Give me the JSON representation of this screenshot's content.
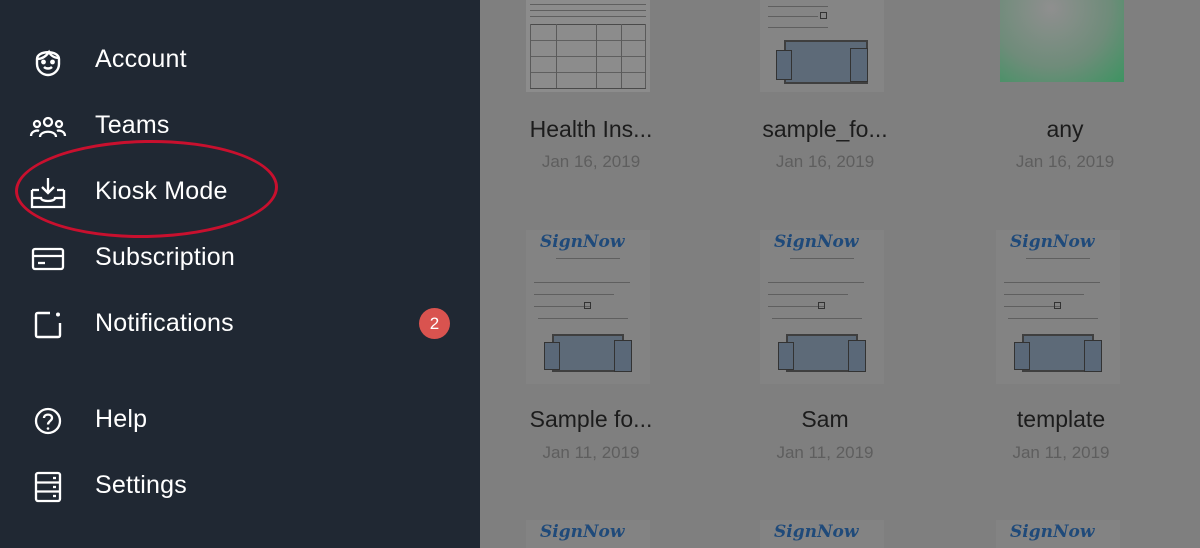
{
  "sidebar": {
    "items": [
      {
        "label": "Account",
        "icon": "account-icon"
      },
      {
        "label": "Teams",
        "icon": "teams-icon"
      },
      {
        "label": "Kiosk Mode",
        "icon": "kiosk-inbox-icon"
      },
      {
        "label": "Subscription",
        "icon": "credit-card-icon"
      },
      {
        "label": "Notifications",
        "icon": "notification-icon",
        "badge": "2"
      },
      {
        "label": "Help",
        "icon": "help-icon"
      },
      {
        "label": "Settings",
        "icon": "settings-icon"
      }
    ]
  },
  "documents": [
    {
      "name": "Health Ins...",
      "date": "Jan 16, 2019"
    },
    {
      "name": "sample_fo...",
      "date": "Jan 16, 2019"
    },
    {
      "name": "any",
      "date": "Jan 16, 2019"
    },
    {
      "name": "Sample fo...",
      "date": "Jan 11, 2019"
    },
    {
      "name": "Sam",
      "date": "Jan 11, 2019"
    },
    {
      "name": "template",
      "date": "Jan 11, 2019"
    }
  ],
  "thumb_logo": "SignNow",
  "colors": {
    "sidebar_bg": "#202833",
    "content_overlay": "#7f7f7f",
    "badge": "#d9534f",
    "highlight_circle": "#c8102e"
  }
}
